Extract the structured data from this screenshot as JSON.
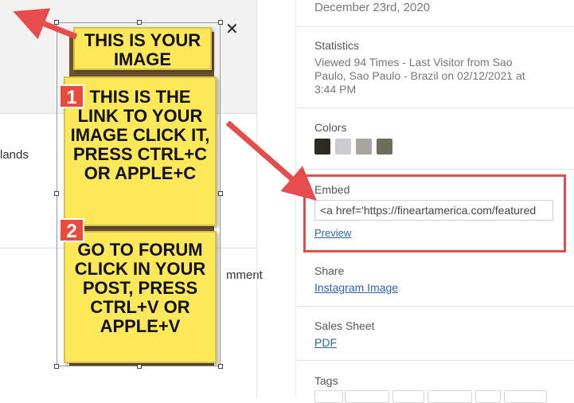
{
  "left": {
    "text_1": "lands",
    "text_2": "mment"
  },
  "panel": {
    "date": "December 23rd, 2020",
    "statistics": {
      "title": "Statistics",
      "line1": "Viewed 94 Times  -  Last Visitor from Sao",
      "line2": "Paulo, Sao Paulo - Brazil on 02/12/2021 at",
      "line3": "3:44 PM"
    },
    "colors": {
      "title": "Colors",
      "swatches": [
        "#2b2b22",
        "#c9cbd0",
        "#a8a49f",
        "#6f6d5c"
      ]
    },
    "embed": {
      "title": "Embed",
      "code": "<a href='https://fineartamerica.com/featured",
      "preview": "Preview"
    },
    "share": {
      "title": "Share",
      "link": "Instagram Image"
    },
    "sales_sheet": {
      "title": "Sales Sheet",
      "link": "PDF"
    },
    "tags": {
      "title": "Tags"
    }
  },
  "overlay": {
    "note_top": "THIS IS YOUR IMAGE",
    "note_1": "THIS IS THE LINK TO YOUR IMAGE CLICK IT, PRESS CTRL+C OR APPLE+C",
    "note_2": "GO TO FORUM CLICK IN YOUR POST, PRESS CTRL+V OR APPLE+V",
    "badge_1": "1",
    "badge_2": "2",
    "close": "✕"
  }
}
